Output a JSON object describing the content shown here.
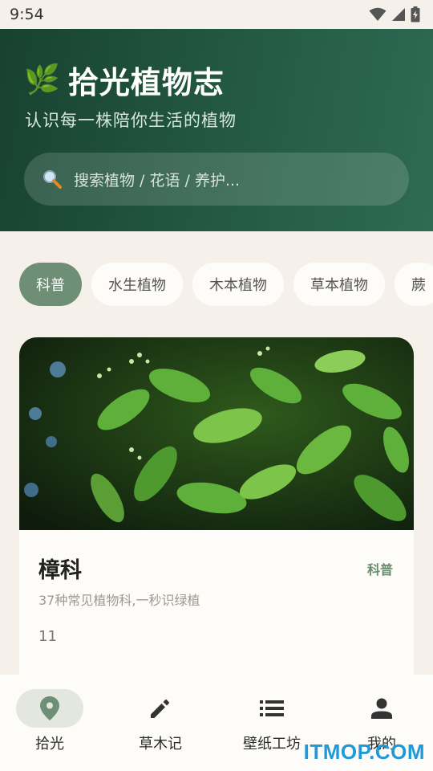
{
  "status_bar": {
    "time": "9:54",
    "wifi_icon": "wifi-icon",
    "signal_icon": "signal-icon",
    "battery_icon": "battery-charging-icon"
  },
  "header": {
    "icon": "leaf-icon",
    "icon_glyph": "🌿",
    "title": "拾光植物志",
    "subtitle": "认识每一株陪你生活的植物",
    "search": {
      "icon": "search-icon",
      "placeholder": "搜索植物 / 花语 / 养护..."
    }
  },
  "chips": [
    {
      "label": "科普",
      "active": true
    },
    {
      "label": "水生植物",
      "active": false
    },
    {
      "label": "木本植物",
      "active": false
    },
    {
      "label": "草本植物",
      "active": false
    },
    {
      "label": "蕨",
      "active": false
    }
  ],
  "card": {
    "image": "camphor-leaves-photo",
    "title": "樟科",
    "badge": "科普",
    "description": "37种常见植物科,一秒识绿植",
    "count": "11"
  },
  "bottom_nav": [
    {
      "label": "拾光",
      "icon": "location-pin-icon",
      "active": true
    },
    {
      "label": "草木记",
      "icon": "pencil-icon",
      "active": false
    },
    {
      "label": "壁纸工坊",
      "icon": "list-icon",
      "active": false
    },
    {
      "label": "我的",
      "icon": "person-icon",
      "active": false
    }
  ],
  "watermark": "ITMOP.COM",
  "colors": {
    "header_dark": "#17422f",
    "header_light": "#2f6a53",
    "accent": "#6e8f75",
    "background": "#f5f1ea",
    "surface": "#fdfcf8"
  }
}
